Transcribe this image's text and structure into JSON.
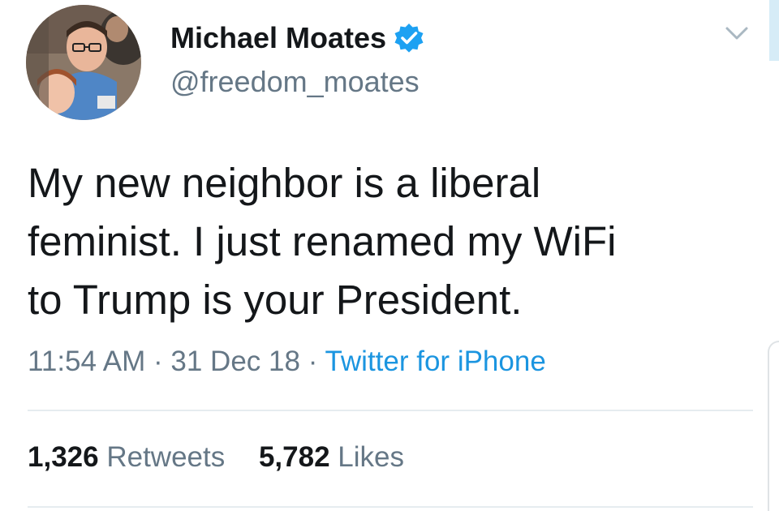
{
  "tweet": {
    "author": {
      "display_name": "Michael Moates",
      "handle": "@freedom_moates",
      "verified": true,
      "avatar_icon": "profile-photo",
      "verified_icon": "verified-badge-icon"
    },
    "text": "My new neighbor is a liberal\nfeminist. I just renamed my WiFi\nto Trump is your President.",
    "time": "11:54 AM",
    "separator": "·",
    "date": "31 Dec 18",
    "source": "Twitter for iPhone",
    "retweets": {
      "count": "1,326",
      "label": "Retweets"
    },
    "likes": {
      "count": "5,782",
      "label": "Likes"
    },
    "menu_icon": "chevron-down-icon"
  },
  "colors": {
    "text": "#14171a",
    "secondary": "#657786",
    "link": "#1b95e0",
    "verified": "#1da1f2",
    "divider": "#e6ecf0"
  }
}
